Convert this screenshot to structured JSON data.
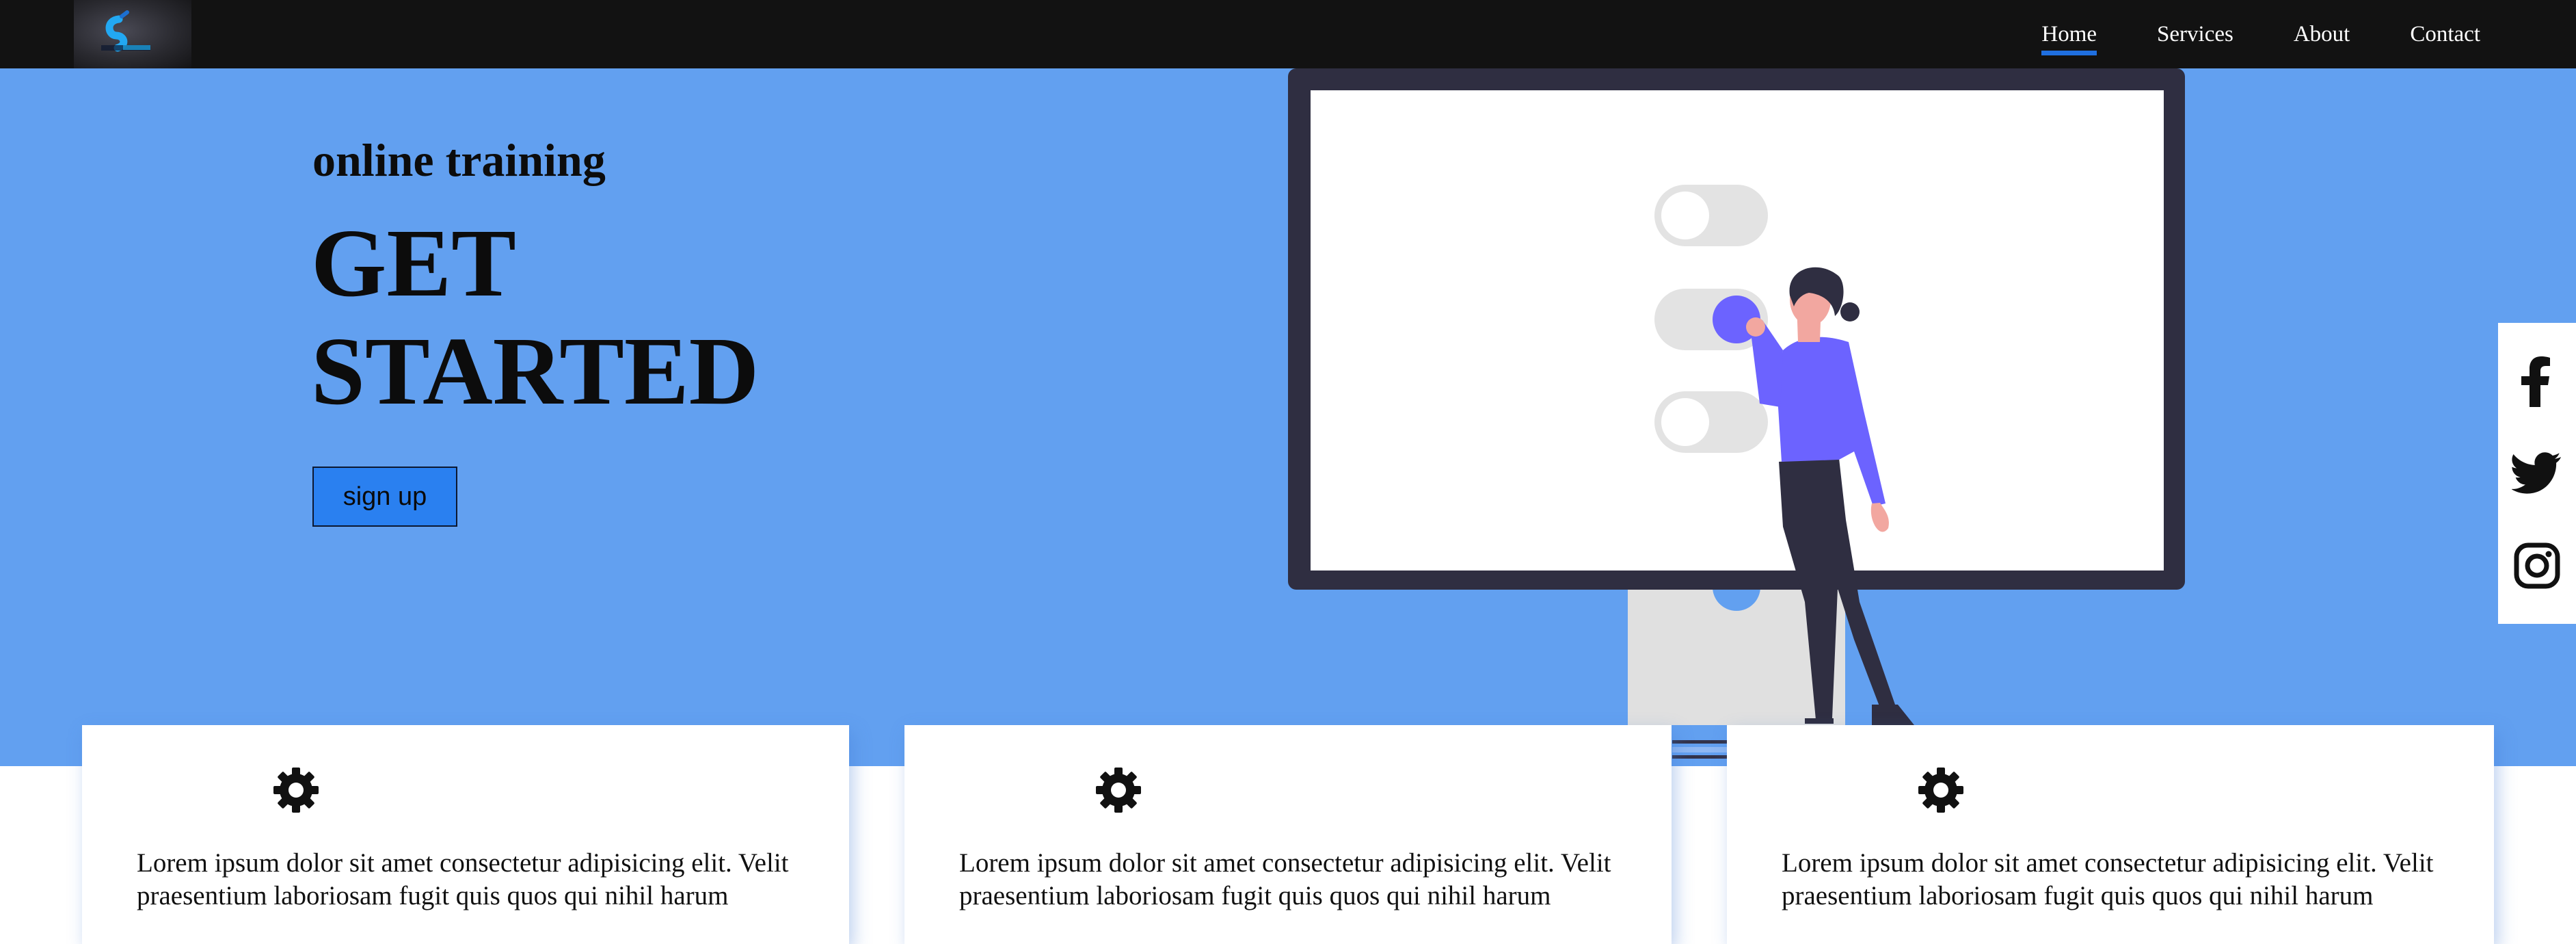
{
  "nav": {
    "links": [
      "Home",
      "Services",
      "About",
      "Contact"
    ],
    "active": "Home"
  },
  "hero": {
    "kicker": "online training",
    "headline_line1": "GET",
    "headline_line2": "STARTED",
    "cta_label": "sign up"
  },
  "social": [
    "facebook-icon",
    "twitter-icon",
    "instagram-icon"
  ],
  "cards": [
    {
      "icon": "gear-icon",
      "text": "Lorem ipsum dolor sit amet consectetur adipisicing elit. Velit praesentium laboriosam fugit quis quos qui nihil harum"
    },
    {
      "icon": "gear-icon",
      "text": "Lorem ipsum dolor sit amet consectetur adipisicing elit. Velit praesentium laboriosam fugit quis quos qui nihil harum"
    },
    {
      "icon": "gear-icon",
      "text": "Lorem ipsum dolor sit amet consectetur adipisicing elit. Velit praesentium laboriosam fugit quis quos qui nihil harum"
    }
  ],
  "colors": {
    "hero_bg": "#62a0f0",
    "nav_bg": "#121212",
    "accent": "#6c63ff",
    "button": "#2a80f0"
  }
}
